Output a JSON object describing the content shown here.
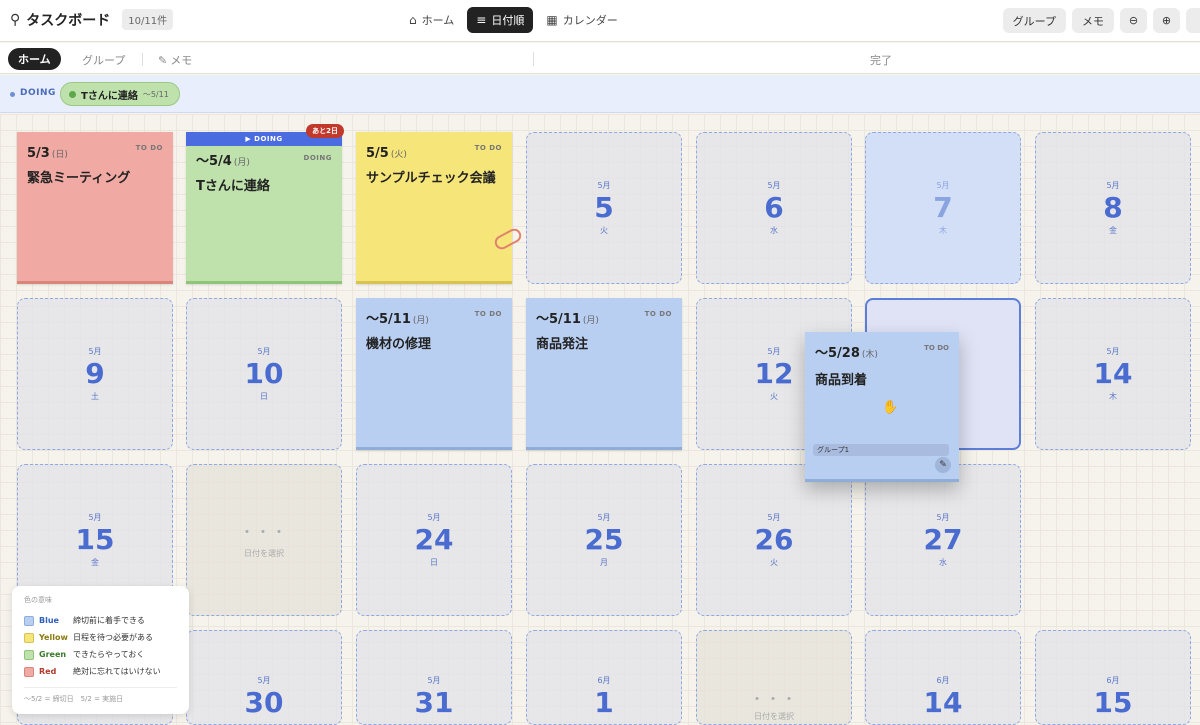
{
  "header": {
    "title": "タスクボード",
    "count": "10/11件",
    "view_tabs": [
      {
        "label": "ホーム",
        "icon": "home-icon"
      },
      {
        "label": "日付順",
        "icon": "filter-icon",
        "active": true
      },
      {
        "label": "カレンダー",
        "icon": "calendar-icon"
      }
    ],
    "tools": {
      "group": "グループ",
      "memo": "メモ"
    }
  },
  "subtabs": {
    "home": "ホーム",
    "group": "グループ",
    "memo": "メモ",
    "done": "完了"
  },
  "doing": {
    "label": "DOING",
    "chip_name": "Tさんに連絡",
    "chip_date": "〜5/11"
  },
  "notes": {
    "n1": {
      "date": "5/3",
      "dow": "(日)",
      "status": "TO DO",
      "title": "緊急ミーティング",
      "color": "#f0aaa3"
    },
    "n2": {
      "date": "〜5/4",
      "dow": "(月)",
      "status": "DOING",
      "title": "Tさんに連絡",
      "band": "▶ DOING",
      "badge": "あと2日",
      "color": "#bfe2ad"
    },
    "n3": {
      "date": "5/5",
      "dow": "(火)",
      "status": "TO DO",
      "title": "サンプルチェック会議",
      "color": "#f6e67a"
    },
    "n4": {
      "date": "〜5/11",
      "dow": "(月)",
      "status": "TO DO",
      "title": "機材の修理",
      "color": "#b9cff2"
    },
    "n5": {
      "date": "〜5/11",
      "dow": "(月)",
      "status": "TO DO",
      "title": "商品発注",
      "color": "#b9cff2"
    },
    "drag": {
      "date": "〜5/28",
      "dow": "(木)",
      "status": "TO DO",
      "title": "商品到着",
      "group": "グループ1",
      "color": "#b9cff2"
    }
  },
  "slots": {
    "r1": [
      {
        "m": "5月",
        "d": "5",
        "w": "火"
      },
      {
        "m": "5月",
        "d": "6",
        "w": "水"
      },
      {
        "m": "5月",
        "d": "7",
        "w": "木"
      },
      {
        "m": "5月",
        "d": "8",
        "w": "金"
      }
    ],
    "r2": [
      {
        "m": "5月",
        "d": "9",
        "w": "土"
      },
      {
        "m": "5月",
        "d": "10",
        "w": "日"
      },
      {
        "m": "5月",
        "d": "12",
        "w": "火"
      },
      {
        "m": "5月",
        "d": "14",
        "w": "木"
      }
    ],
    "r3": [
      {
        "m": "5月",
        "d": "15",
        "w": "金"
      },
      {
        "m": "5月",
        "d": "24",
        "w": "日"
      },
      {
        "m": "5月",
        "d": "25",
        "w": "月"
      },
      {
        "m": "5月",
        "d": "26",
        "w": "火"
      },
      {
        "m": "5月",
        "d": "27",
        "w": "水"
      }
    ],
    "r4": [
      {
        "m": "5月",
        "d": "30",
        "w": ""
      },
      {
        "m": "5月",
        "d": "31",
        "w": ""
      },
      {
        "m": "6月",
        "d": "1",
        "w": ""
      },
      {
        "m": "6月",
        "d": "14",
        "w": ""
      },
      {
        "m": "6月",
        "d": "15",
        "w": ""
      }
    ],
    "empty_dots": "・・・",
    "empty_hint": "日付を選択"
  },
  "legend": {
    "title": "色の意味",
    "items": [
      {
        "name": "Blue",
        "desc": "締切前に着手できる",
        "color": "#b9cff2",
        "text_color": "#2f5fbf"
      },
      {
        "name": "Yellow",
        "desc": "日程を待つ必要がある",
        "color": "#f6e67a",
        "text_color": "#8a7a10"
      },
      {
        "name": "Green",
        "desc": "できたらやっておく",
        "color": "#bfe2ad",
        "text_color": "#3a7a2a"
      },
      {
        "name": "Red",
        "desc": "絶対に忘れてはいけない",
        "color": "#f0aaa3",
        "text_color": "#b03a2e"
      }
    ],
    "footer": "〜5/2 = 締切日　5/2 = 実施日"
  }
}
